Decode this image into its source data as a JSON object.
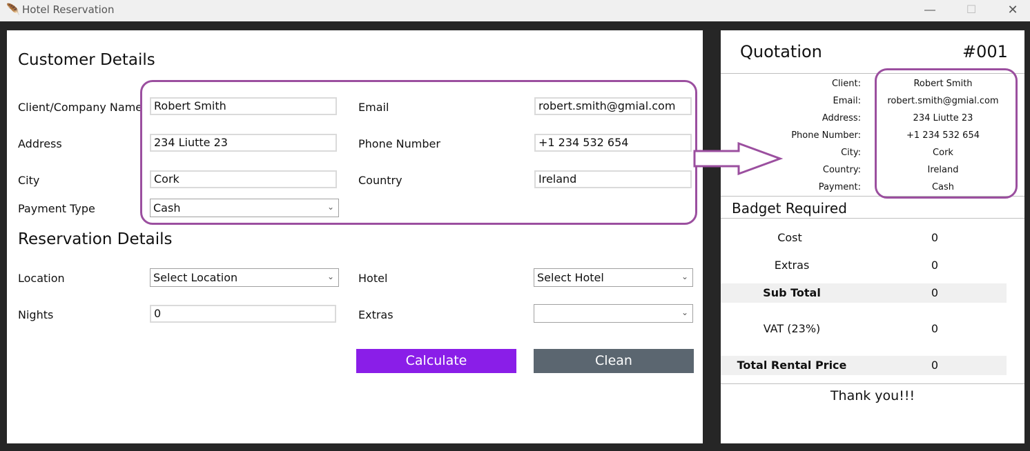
{
  "window": {
    "title": "Hotel Reservation",
    "minimize_glyph": "—",
    "maximize_glyph": "☐",
    "close_glyph": "✕",
    "app_icon": "feather-icon"
  },
  "customer": {
    "title": "Customer Details",
    "name_label": "Client/Company Name",
    "name_value": "Robert Smith",
    "email_label": "Email",
    "email_value": "robert.smith@gmial.com",
    "address_label": "Address",
    "address_value": "234 Liutte 23",
    "phone_label": "Phone Number",
    "phone_value": "+1 234 532 654",
    "city_label": "City",
    "city_value": "Cork",
    "country_label": "Country",
    "country_value": "Ireland",
    "payment_label": "Payment Type",
    "payment_value": "Cash"
  },
  "reservation": {
    "title": "Reservation Details",
    "location_label": "Location",
    "location_value": "Select Location",
    "hotel_label": "Hotel",
    "hotel_value": "Select Hotel",
    "nights_label": "Nights",
    "nights_value": "0",
    "extras_label": "Extras",
    "extras_value": ""
  },
  "buttons": {
    "calculate": "Calculate",
    "clean": "Clean",
    "calculate_color": "#8a1ee8",
    "clean_color": "#5b6670"
  },
  "quotation": {
    "title": "Quotation",
    "number": "#001",
    "rows": [
      {
        "label": "Client:",
        "value": "Robert Smith"
      },
      {
        "label": "Email:",
        "value": "robert.smith@gmial.com"
      },
      {
        "label": "Address:",
        "value": "234 Liutte 23"
      },
      {
        "label": "Phone Number:",
        "value": "+1 234 532 654"
      },
      {
        "label": "City:",
        "value": "Cork"
      },
      {
        "label": "Country:",
        "value": "Ireland"
      },
      {
        "label": "Payment:",
        "value": "Cash"
      }
    ]
  },
  "budget": {
    "title": "Badget Required",
    "rows": [
      {
        "label": "Cost",
        "value": "0"
      },
      {
        "label": "Extras",
        "value": "0"
      },
      {
        "label": "Sub Total",
        "value": "0"
      },
      {
        "label": "VAT (23%)",
        "value": "0"
      },
      {
        "label": "Total Rental Price",
        "value": "0"
      }
    ],
    "footer": "Thank you!!!"
  },
  "annotation": {
    "color": "#9b4f9f"
  }
}
